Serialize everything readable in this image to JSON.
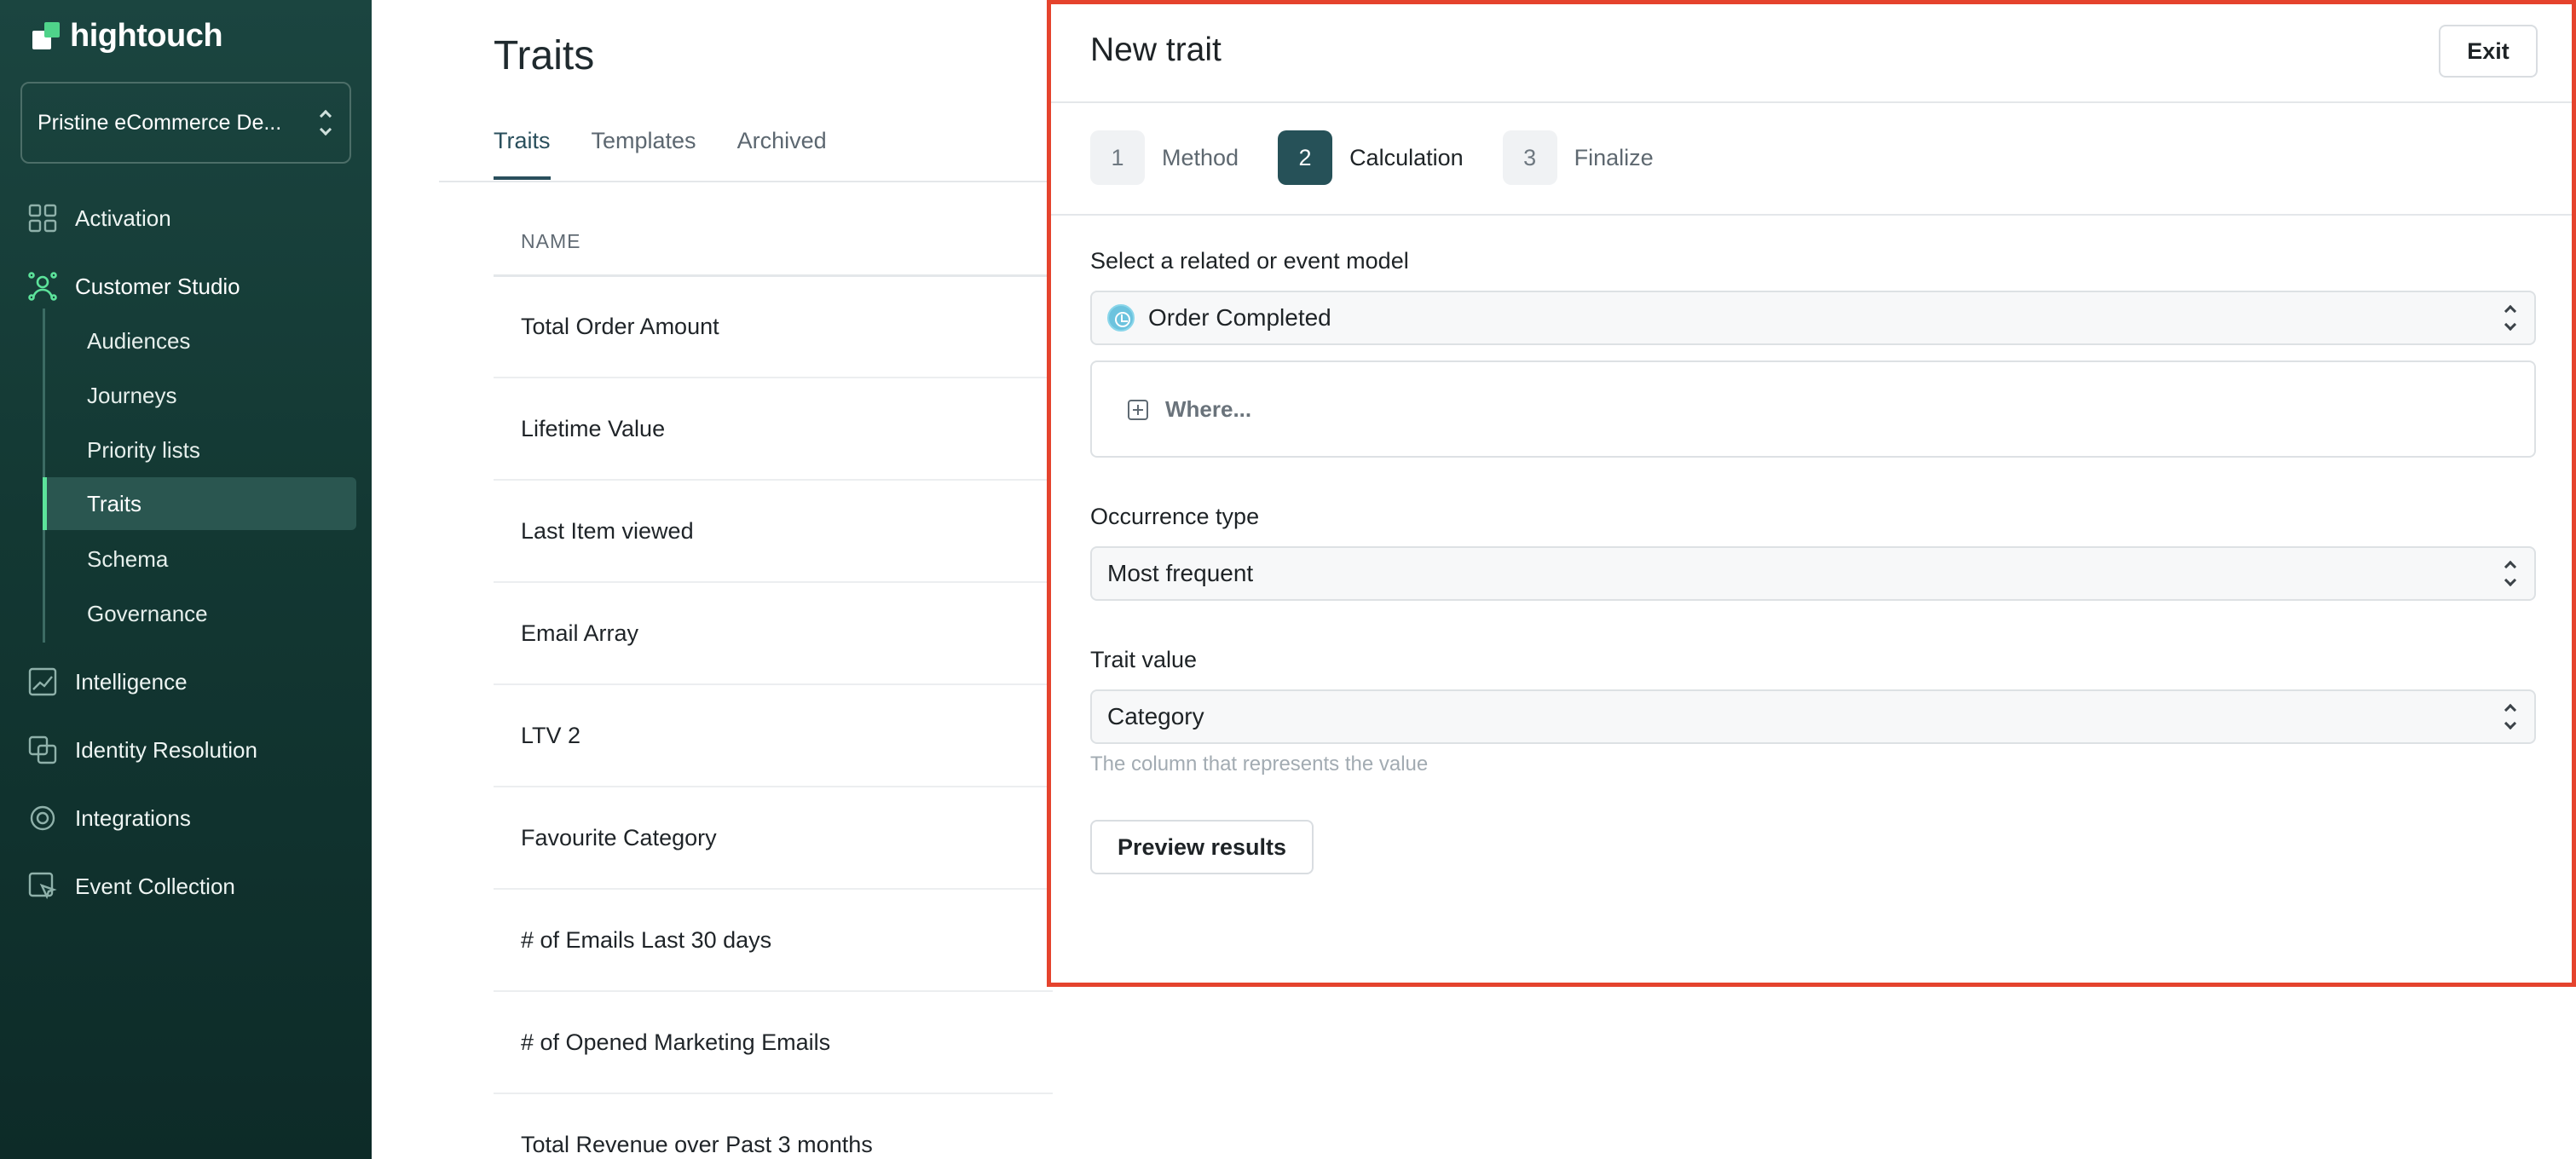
{
  "sidebar": {
    "logo_text": "hightouch",
    "workspace": "Pristine eCommerce De...",
    "nav": [
      {
        "label": "Activation",
        "icon": "grid-icon"
      },
      {
        "label": "Customer Studio",
        "icon": "people-icon"
      },
      {
        "label": "Intelligence",
        "icon": "chart-icon"
      },
      {
        "label": "Identity Resolution",
        "icon": "identity-icon"
      },
      {
        "label": "Integrations",
        "icon": "integrations-icon"
      },
      {
        "label": "Event Collection",
        "icon": "cursor-icon"
      }
    ],
    "sub_items": [
      "Audiences",
      "Journeys",
      "Priority lists",
      "Traits",
      "Schema",
      "Governance"
    ],
    "selected_sub_item": "Traits",
    "accent_color": "#5ce39b"
  },
  "main": {
    "title": "Traits",
    "tabs": [
      "Traits",
      "Templates",
      "Archived"
    ],
    "active_tab": "Traits",
    "column_header": "NAME",
    "rows": [
      "Total Order Amount",
      "Lifetime Value",
      "Last Item viewed",
      "Email Array",
      "LTV 2",
      "Favourite Category",
      "# of Emails Last 30 days",
      "# of Opened Marketing Emails",
      "Total Revenue over Past 3 months"
    ]
  },
  "panel": {
    "title": "New trait",
    "exit_label": "Exit",
    "highlight_color": "#e5432d",
    "steps": [
      {
        "number": "1",
        "label": "Method"
      },
      {
        "number": "2",
        "label": "Calculation"
      },
      {
        "number": "3",
        "label": "Finalize"
      }
    ],
    "current_step": "2",
    "model_label": "Select a related or event model",
    "model_value": "Order Completed",
    "where_label": "Where...",
    "occurrence_label": "Occurrence type",
    "occurrence_value": "Most frequent",
    "trait_value_label": "Trait value",
    "trait_value": "Category",
    "trait_value_helper": "The column that represents the value",
    "preview_label": "Preview results"
  }
}
